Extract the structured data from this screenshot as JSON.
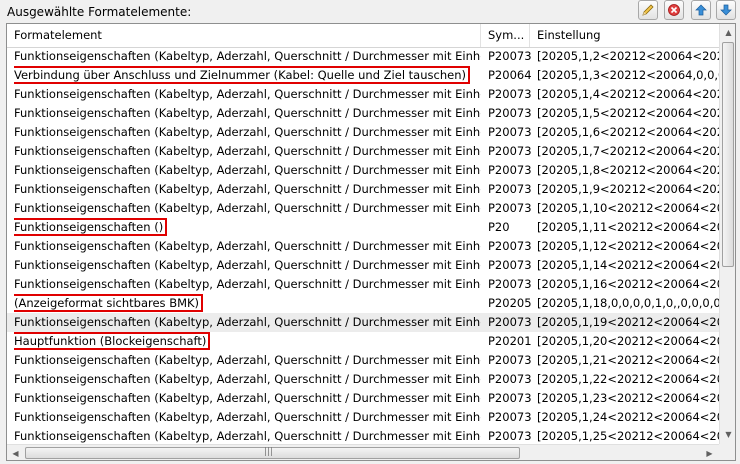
{
  "panel": {
    "title": "Ausgewählte Formatelemente:"
  },
  "toolbar": [
    {
      "icon": "pencil-icon"
    },
    {
      "icon": "delete-icon"
    },
    {
      "icon": "arrow-up-icon"
    },
    {
      "icon": "arrow-down-icon"
    }
  ],
  "table": {
    "columns": [
      "Formatelement",
      "Sym...",
      "Einstellung"
    ],
    "rows": [
      {
        "name": "Funktionseigenschaften (Kabeltyp, Aderzahl, Querschnitt / Durchmesser mit Einheit)",
        "sym": "P20073",
        "setting": "[20205,1,2<20212<20064<20201<20"
      },
      {
        "name": "Verbindung über Anschluss und Zielnummer (Kabel: Quelle und Ziel tauschen)",
        "sym": "P20064",
        "setting": "[20205,1,3<20212<20064,0,0,0,0,1,0,",
        "highlight": true
      },
      {
        "name": "Funktionseigenschaften (Kabeltyp, Aderzahl, Querschnitt / Durchmesser mit Einheit)",
        "sym": "P20073",
        "setting": "[20205,1,4<20212<20064<20201<20"
      },
      {
        "name": "Funktionseigenschaften (Kabeltyp, Aderzahl, Querschnitt / Durchmesser mit Einheit)",
        "sym": "P20073",
        "setting": "[20205,1,5<20212<20064<20201<20"
      },
      {
        "name": "Funktionseigenschaften (Kabeltyp, Aderzahl, Querschnitt / Durchmesser mit Einheit)",
        "sym": "P20073",
        "setting": "[20205,1,6<20212<20064<20201<20"
      },
      {
        "name": "Funktionseigenschaften (Kabeltyp, Aderzahl, Querschnitt / Durchmesser mit Einheit)",
        "sym": "P20073",
        "setting": "[20205,1,7<20212<20064<20201<20"
      },
      {
        "name": "Funktionseigenschaften (Kabeltyp, Aderzahl, Querschnitt / Durchmesser mit Einheit)",
        "sym": "P20073",
        "setting": "[20205,1,8<20212<20064<20201<20"
      },
      {
        "name": "Funktionseigenschaften (Kabeltyp, Aderzahl, Querschnitt / Durchmesser mit Einheit)",
        "sym": "P20073",
        "setting": "[20205,1,9<20212<20064<20201<20"
      },
      {
        "name": "Funktionseigenschaften (Kabeltyp, Aderzahl, Querschnitt / Durchmesser mit Einheit)",
        "sym": "P20073",
        "setting": "[20205,1,10<20212<20064<20201<2"
      },
      {
        "name": "Funktionseigenschaften ()",
        "sym": "P20",
        "setting": "[20205,1,11<20212<20064<20201<2",
        "highlight": true
      },
      {
        "name": "Funktionseigenschaften (Kabeltyp, Aderzahl, Querschnitt / Durchmesser mit Einheit)",
        "sym": "P20073",
        "setting": "[20205,1,12<20212<20064<20201<2"
      },
      {
        "name": "Funktionseigenschaften (Kabeltyp, Aderzahl, Querschnitt / Durchmesser mit Einheit)",
        "sym": "P20073",
        "setting": "[20205,1,14<20212<20064<20201<2"
      },
      {
        "name": "Funktionseigenschaften (Kabeltyp, Aderzahl, Querschnitt / Durchmesser mit Einheit)",
        "sym": "P20073",
        "setting": "[20205,1,16<20212<20064<20201<2"
      },
      {
        "name": "(Anzeigeformat sichtbares BMK)",
        "sym": "P20205",
        "setting": "[20205,1,18,0,0,0,0,1,0,,0,0,0,0,0]",
        "highlight": true
      },
      {
        "name": "Funktionseigenschaften (Kabeltyp, Aderzahl, Querschnitt / Durchmesser mit Einheit)",
        "sym": "P20073",
        "setting": "[20205,1,19<20212<20064<20201<2",
        "selected": true
      },
      {
        "name": "Hauptfunktion (Blockeigenschaft)",
        "sym": "P20201",
        "setting": "[20205,1,20<20212<20064<20201,0,",
        "highlight": true
      },
      {
        "name": "Funktionseigenschaften (Kabeltyp, Aderzahl, Querschnitt / Durchmesser mit Einheit)",
        "sym": "P20073",
        "setting": "[20205,1,21<20212<20064<20201<2"
      },
      {
        "name": "Funktionseigenschaften (Kabeltyp, Aderzahl, Querschnitt / Durchmesser mit Einheit)",
        "sym": "P20073",
        "setting": "[20205,1,22<20212<20064<20201<2"
      },
      {
        "name": "Funktionseigenschaften (Kabeltyp, Aderzahl, Querschnitt / Durchmesser mit Einheit)",
        "sym": "P20073",
        "setting": "[20205,1,23<20212<20064<20201<2"
      },
      {
        "name": "Funktionseigenschaften (Kabeltyp, Aderzahl, Querschnitt / Durchmesser mit Einheit)",
        "sym": "P20073",
        "setting": "[20205,1,24<20212<20064<20201<2"
      },
      {
        "name": "Funktionseigenschaften (Kabeltyp, Aderzahl, Querschnitt / Durchmesser mit Einheit)",
        "sym": "P20073",
        "setting": "[20205,1,25<20212<20064<20201<2"
      }
    ]
  },
  "colors": {
    "highlight_border": "#e00000",
    "selected_row": "#ececec"
  }
}
